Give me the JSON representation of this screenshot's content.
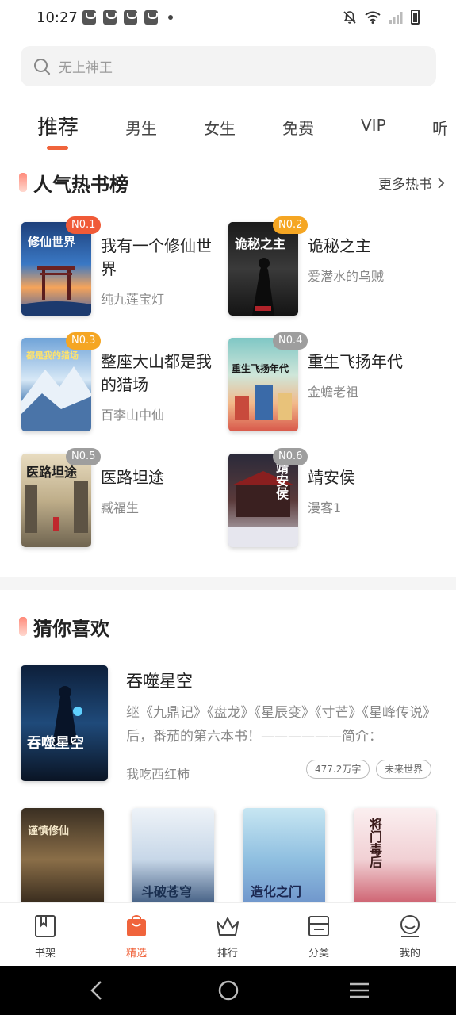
{
  "status_bar": {
    "time": "10:27"
  },
  "search": {
    "placeholder": "无上神王"
  },
  "tabs": [
    {
      "label": "推荐",
      "active": true
    },
    {
      "label": "男生"
    },
    {
      "label": "女生"
    },
    {
      "label": "免费"
    },
    {
      "label": "VIP"
    },
    {
      "label": "听"
    }
  ],
  "hot": {
    "title": "人气热书榜",
    "more": "更多热书",
    "books": [
      {
        "rank": "N0.1",
        "title": "我有一个修仙世界",
        "author": "纯九莲宝灯",
        "cover_text": "修仙世界"
      },
      {
        "rank": "N0.2",
        "title": "诡秘之主",
        "author": "爱潜水的乌贼",
        "cover_text": "诡秘之主"
      },
      {
        "rank": "N0.3",
        "title": "整座大山都是我的猎场",
        "author": "百李山中仙",
        "cover_text": "都是我的猎场"
      },
      {
        "rank": "N0.4",
        "title": "重生飞扬年代",
        "author": "金蟾老祖",
        "cover_text": "重生飞扬年代"
      },
      {
        "rank": "N0.5",
        "title": "医路坦途",
        "author": "臧福生",
        "cover_text": "医路坦途"
      },
      {
        "rank": "N0.6",
        "title": "靖安侯",
        "author": "漫客1",
        "cover_text": "靖安侯"
      }
    ]
  },
  "guess": {
    "title": "猜你喜欢",
    "featured": {
      "title": "吞噬星空",
      "desc": "继《九鼎记》《盘龙》《星辰变》《寸芒》《星峰传说》后，番茄的第六本书！——————简介：",
      "author": "我吃西红柿",
      "tags": [
        "477.2万字",
        "未来世界"
      ],
      "cover_text": "吞噬星空"
    },
    "row": [
      {
        "cover_text": "谨慎修仙"
      },
      {
        "cover_text": "斗破苍穹"
      },
      {
        "cover_text": "造化之门"
      },
      {
        "cover_text": "将门毒后"
      }
    ]
  },
  "bottom_nav": [
    {
      "label": "书架"
    },
    {
      "label": "精选",
      "active": true
    },
    {
      "label": "排行"
    },
    {
      "label": "分类"
    },
    {
      "label": "我的"
    }
  ],
  "colors": {
    "accent": "#f0643c",
    "badge_top1": "#f05a37",
    "badge_top2": "#f5a623",
    "badge_other": "#9e9e9e"
  }
}
